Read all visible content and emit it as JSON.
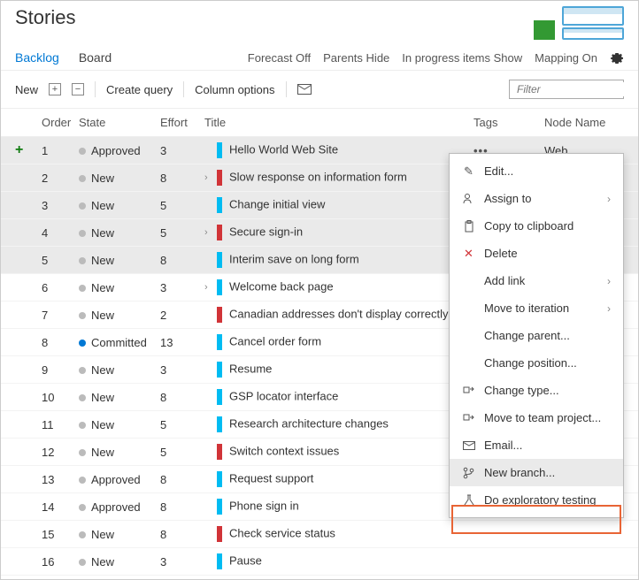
{
  "title": "Stories",
  "tabs": {
    "backlog": "Backlog",
    "board": "Board"
  },
  "viewOptions": {
    "forecast": {
      "label": "Forecast",
      "value": "Off"
    },
    "parents": {
      "label": "Parents",
      "value": "Hide"
    },
    "inprogress": {
      "label": "In progress items",
      "value": "Show"
    },
    "mapping": {
      "label": "Mapping",
      "value": "On"
    }
  },
  "toolbar": {
    "new": "New",
    "createQuery": "Create query",
    "columnOptions": "Column options",
    "filterPlaceholder": "Filter"
  },
  "columns": {
    "order": "Order",
    "state": "State",
    "effort": "Effort",
    "title": "Title",
    "tags": "Tags",
    "node": "Node Name"
  },
  "rows": [
    {
      "order": "1",
      "state": "Approved",
      "dot": "grey",
      "effort": "3",
      "bar": "blue",
      "chev": false,
      "title": "Hello World Web Site",
      "node": "Web",
      "sel": true,
      "add": true,
      "ell": true
    },
    {
      "order": "2",
      "state": "New",
      "dot": "grey",
      "effort": "8",
      "bar": "red",
      "chev": true,
      "title": "Slow response on information form",
      "sel": true
    },
    {
      "order": "3",
      "state": "New",
      "dot": "grey",
      "effort": "5",
      "bar": "blue",
      "chev": false,
      "title": "Change initial view",
      "sel": true
    },
    {
      "order": "4",
      "state": "New",
      "dot": "grey",
      "effort": "5",
      "bar": "red",
      "chev": true,
      "title": "Secure sign-in",
      "sel": true
    },
    {
      "order": "5",
      "state": "New",
      "dot": "grey",
      "effort": "8",
      "bar": "blue",
      "chev": false,
      "title": "Interim save on long form",
      "sel": true
    },
    {
      "order": "6",
      "state": "New",
      "dot": "grey",
      "effort": "3",
      "bar": "blue",
      "chev": true,
      "title": "Welcome back page"
    },
    {
      "order": "7",
      "state": "New",
      "dot": "grey",
      "effort": "2",
      "bar": "red",
      "chev": false,
      "title": "Canadian addresses don't display correctly"
    },
    {
      "order": "8",
      "state": "Committed",
      "dot": "blue",
      "effort": "13",
      "bar": "blue",
      "chev": false,
      "title": "Cancel order form"
    },
    {
      "order": "9",
      "state": "New",
      "dot": "grey",
      "effort": "3",
      "bar": "blue",
      "chev": false,
      "title": "Resume"
    },
    {
      "order": "10",
      "state": "New",
      "dot": "grey",
      "effort": "8",
      "bar": "blue",
      "chev": false,
      "title": "GSP locator interface"
    },
    {
      "order": "11",
      "state": "New",
      "dot": "grey",
      "effort": "5",
      "bar": "blue",
      "chev": false,
      "title": "Research architecture changes"
    },
    {
      "order": "12",
      "state": "New",
      "dot": "grey",
      "effort": "5",
      "bar": "red",
      "chev": false,
      "title": "Switch context issues"
    },
    {
      "order": "13",
      "state": "Approved",
      "dot": "grey",
      "effort": "8",
      "bar": "blue",
      "chev": false,
      "title": "Request support"
    },
    {
      "order": "14",
      "state": "Approved",
      "dot": "grey",
      "effort": "8",
      "bar": "blue",
      "chev": false,
      "title": "Phone sign in"
    },
    {
      "order": "15",
      "state": "New",
      "dot": "grey",
      "effort": "8",
      "bar": "red",
      "chev": false,
      "title": "Check service status"
    },
    {
      "order": "16",
      "state": "New",
      "dot": "grey",
      "effort": "3",
      "bar": "blue",
      "chev": false,
      "title": "Pause"
    }
  ],
  "ctx": {
    "edit": "Edit...",
    "assign": "Assign to",
    "copy": "Copy to clipboard",
    "delete": "Delete",
    "addlink": "Add link",
    "moveiter": "Move to iteration",
    "chparent": "Change parent...",
    "chpos": "Change position...",
    "chtype": "Change type...",
    "moveproj": "Move to team project...",
    "email": "Email...",
    "newbranch": "New branch...",
    "explore": "Do exploratory testing"
  }
}
